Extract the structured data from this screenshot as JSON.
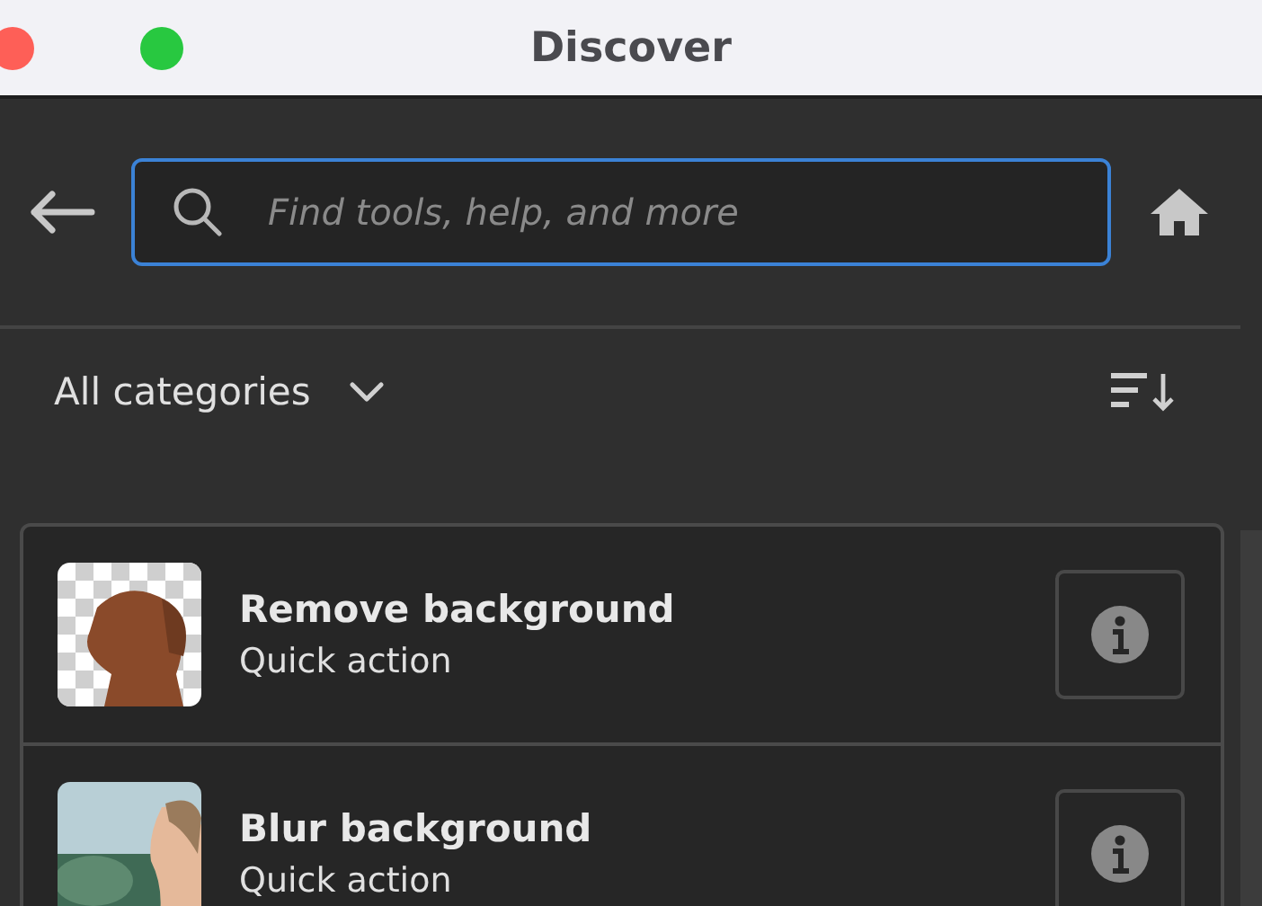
{
  "window": {
    "title": "Discover"
  },
  "search": {
    "placeholder": "Find tools, help, and more"
  },
  "filter": {
    "label": "All categories"
  },
  "results": [
    {
      "title": "Remove background",
      "subtitle": "Quick action",
      "kind": "picture"
    },
    {
      "title": "Blur background",
      "subtitle": "Quick action",
      "kind": "picture"
    }
  ]
}
